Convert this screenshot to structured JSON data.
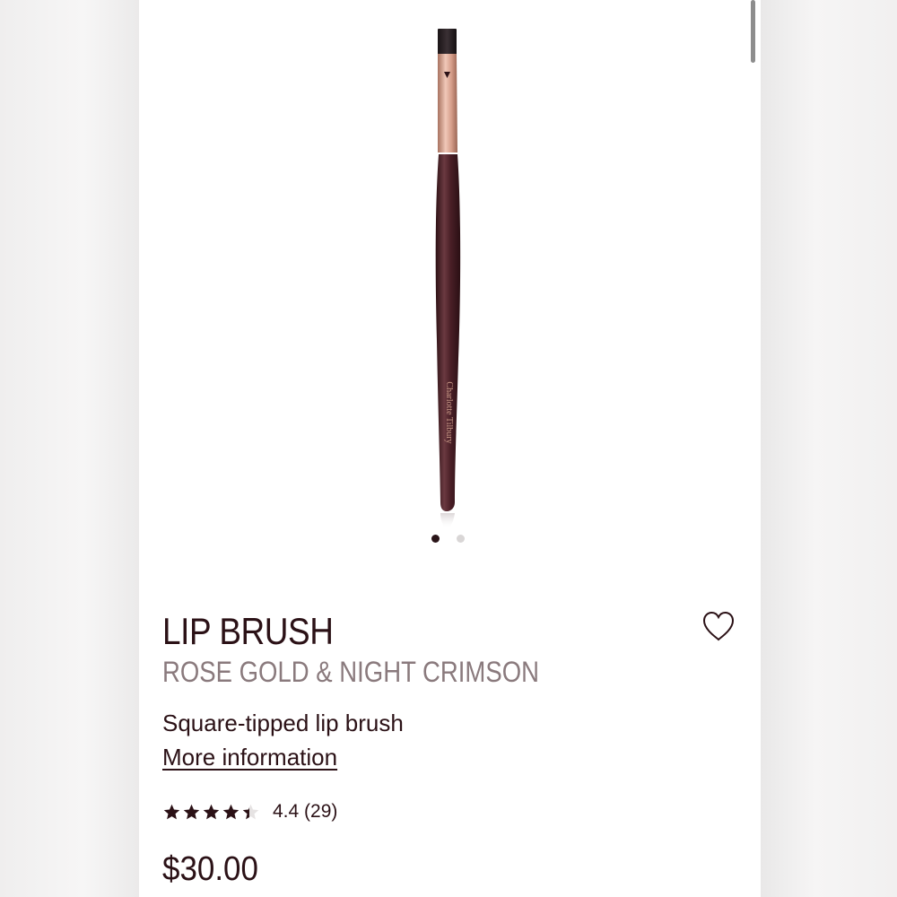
{
  "product": {
    "name": "LIP BRUSH",
    "shade": "ROSE GOLD & NIGHT CRIMSON",
    "description": "Square-tipped lip brush",
    "more_info_label": "More information",
    "rating_text": "4.4 (29)",
    "rating_value": 4.4,
    "rating_max": 5,
    "price": "$30.00",
    "brand_on_handle": "Charlotte Tilbury"
  },
  "carousel": {
    "total_images": 2,
    "active_index": 0
  },
  "colors": {
    "text_primary": "#2b1116",
    "text_secondary": "#8a7a7d",
    "rose_gold": "#c99a88",
    "night_crimson": "#4a1f27"
  }
}
